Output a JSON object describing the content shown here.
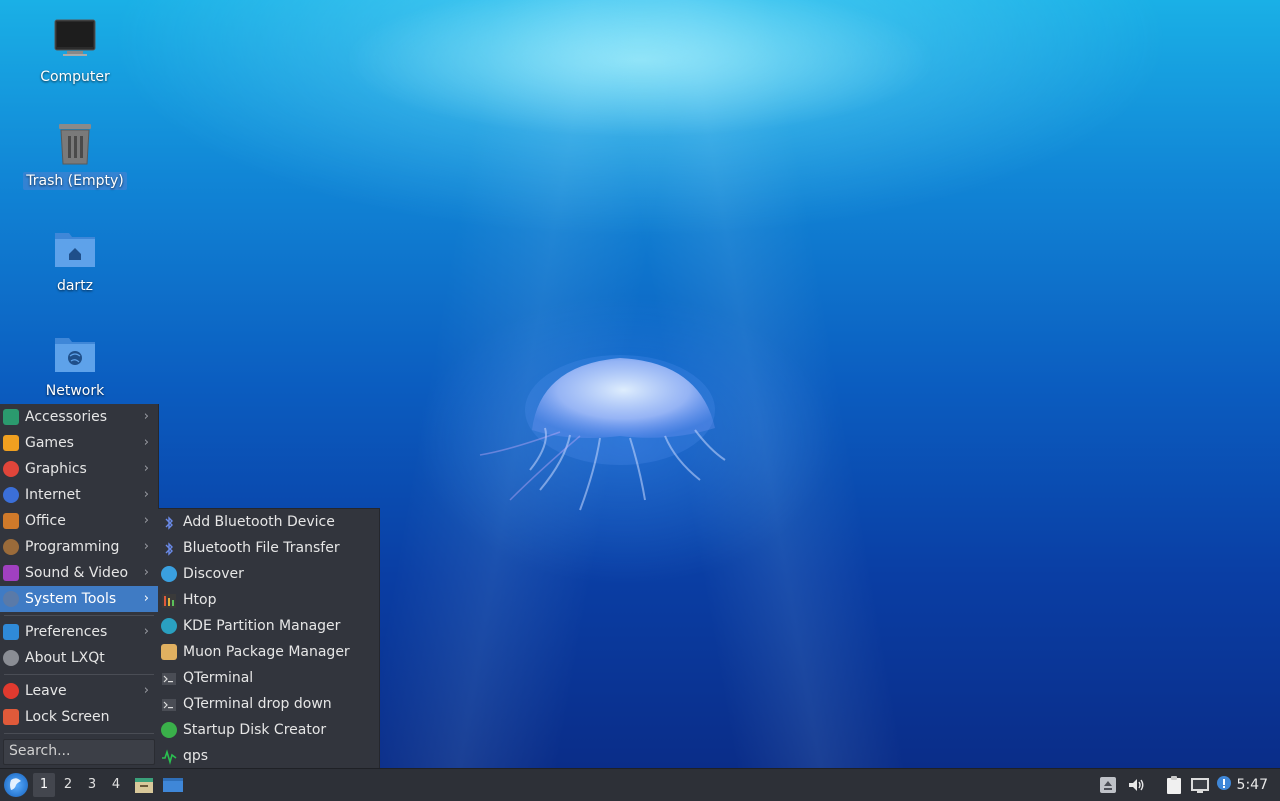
{
  "desktop": {
    "icons": [
      {
        "label": "Computer",
        "icon": "computer-icon"
      },
      {
        "label": "Trash (Empty)",
        "icon": "trash-icon",
        "selected": true
      },
      {
        "label": "dartz",
        "icon": "home-folder-icon"
      },
      {
        "label": "Network",
        "icon": "network-folder-icon"
      }
    ]
  },
  "menu": {
    "items": [
      {
        "label": "Accessories",
        "arrow": "›",
        "color": "#2b9a6e"
      },
      {
        "label": "Games",
        "arrow": "›",
        "color": "#f0a020"
      },
      {
        "label": "Graphics",
        "arrow": "›",
        "color": "#e0453a"
      },
      {
        "label": "Internet",
        "arrow": "›",
        "color": "#3b6fd8"
      },
      {
        "label": "Office",
        "arrow": "›",
        "color": "#d07a2a"
      },
      {
        "label": "Programming",
        "arrow": "›",
        "color": "#9a6b3a"
      },
      {
        "label": "Sound & Video",
        "arrow": "›",
        "color": "#a040c0"
      },
      {
        "label": "System Tools",
        "arrow": "›",
        "color": "#5a7aa8",
        "active": true
      },
      {
        "label": "Preferences",
        "arrow": "›",
        "color": "#2f8ad8"
      },
      {
        "label": "About LXQt",
        "arrow": "",
        "color": "#8a8d94"
      },
      {
        "label": "Leave",
        "arrow": "›",
        "color": "#e03a2f"
      },
      {
        "label": "Lock Screen",
        "arrow": "",
        "color": "#e05a3a"
      }
    ],
    "search_placeholder": "Search..."
  },
  "submenu": {
    "items": [
      {
        "label": "Add Bluetooth Device",
        "icon": "bluetooth-icon",
        "color": "#3a5fc8"
      },
      {
        "label": "Bluetooth File Transfer",
        "icon": "bluetooth-icon",
        "color": "#3a5fc8"
      },
      {
        "label": "Discover",
        "icon": "discover-icon",
        "color": "#3aa0e0"
      },
      {
        "label": "Htop",
        "icon": "htop-icon",
        "color": "#7a5a3a"
      },
      {
        "label": "KDE Partition Manager",
        "icon": "partition-icon",
        "color": "#2aa0c0"
      },
      {
        "label": "Muon Package Manager",
        "icon": "package-icon",
        "color": "#e0b060"
      },
      {
        "label": "QTerminal",
        "icon": "terminal-icon",
        "color": "#4a4d55"
      },
      {
        "label": "QTerminal drop down",
        "icon": "terminal-icon",
        "color": "#4a4d55"
      },
      {
        "label": "Startup Disk Creator",
        "icon": "disk-creator-icon",
        "color": "#3ab04a"
      },
      {
        "label": "qps",
        "icon": "qps-icon",
        "color": "#2ac050"
      }
    ]
  },
  "taskbar": {
    "desktops": [
      "1",
      "2",
      "3",
      "4"
    ],
    "active_desktop": "1",
    "clock": "5:47"
  }
}
